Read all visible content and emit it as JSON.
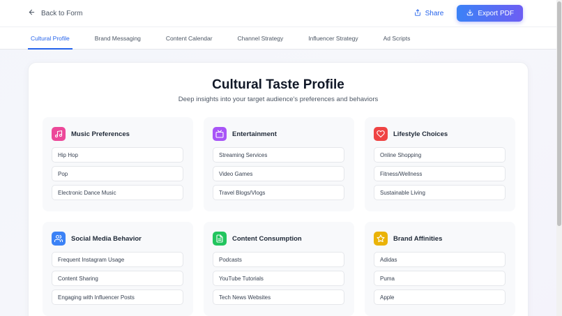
{
  "header": {
    "back_label": "Back to Form",
    "share_label": "Share",
    "export_label": "Export PDF"
  },
  "tabs": [
    {
      "label": "Cultural Profile",
      "active": true
    },
    {
      "label": "Brand Messaging",
      "active": false
    },
    {
      "label": "Content Calendar",
      "active": false
    },
    {
      "label": "Channel Strategy",
      "active": false
    },
    {
      "label": "Influencer Strategy",
      "active": false
    },
    {
      "label": "Ad Scripts",
      "active": false
    }
  ],
  "profile": {
    "title": "Cultural Taste Profile",
    "subtitle": "Deep insights into your target audience's preferences and behaviors",
    "sections": [
      {
        "title": "Music Preferences",
        "icon": "music-icon",
        "color": "#ec4899",
        "items": [
          "Hip Hop",
          "Pop",
          "Electronic Dance Music"
        ]
      },
      {
        "title": "Entertainment",
        "icon": "tv-icon",
        "color": "#a855f7",
        "items": [
          "Streaming Services",
          "Video Games",
          "Travel Blogs/Vlogs"
        ]
      },
      {
        "title": "Lifestyle Choices",
        "icon": "heart-icon",
        "color": "#ef4444",
        "items": [
          "Online Shopping",
          "Fitness/Wellness",
          "Sustainable Living"
        ]
      },
      {
        "title": "Social Media Behavior",
        "icon": "users-icon",
        "color": "#3b82f6",
        "items": [
          "Frequent Instagram Usage",
          "Content Sharing",
          "Engaging with Influencer Posts"
        ]
      },
      {
        "title": "Content Consumption",
        "icon": "document-icon",
        "color": "#22c55e",
        "items": [
          "Podcasts",
          "YouTube Tutorials",
          "Tech News Websites"
        ]
      },
      {
        "title": "Brand Affinities",
        "icon": "star-icon",
        "color": "#eab308",
        "items": [
          "Adidas",
          "Puma",
          "Apple"
        ]
      }
    ]
  },
  "colors": {
    "accent": "#2563eb",
    "export_gradient_start": "#3b82f6",
    "export_gradient_end": "#6d5ef3"
  }
}
